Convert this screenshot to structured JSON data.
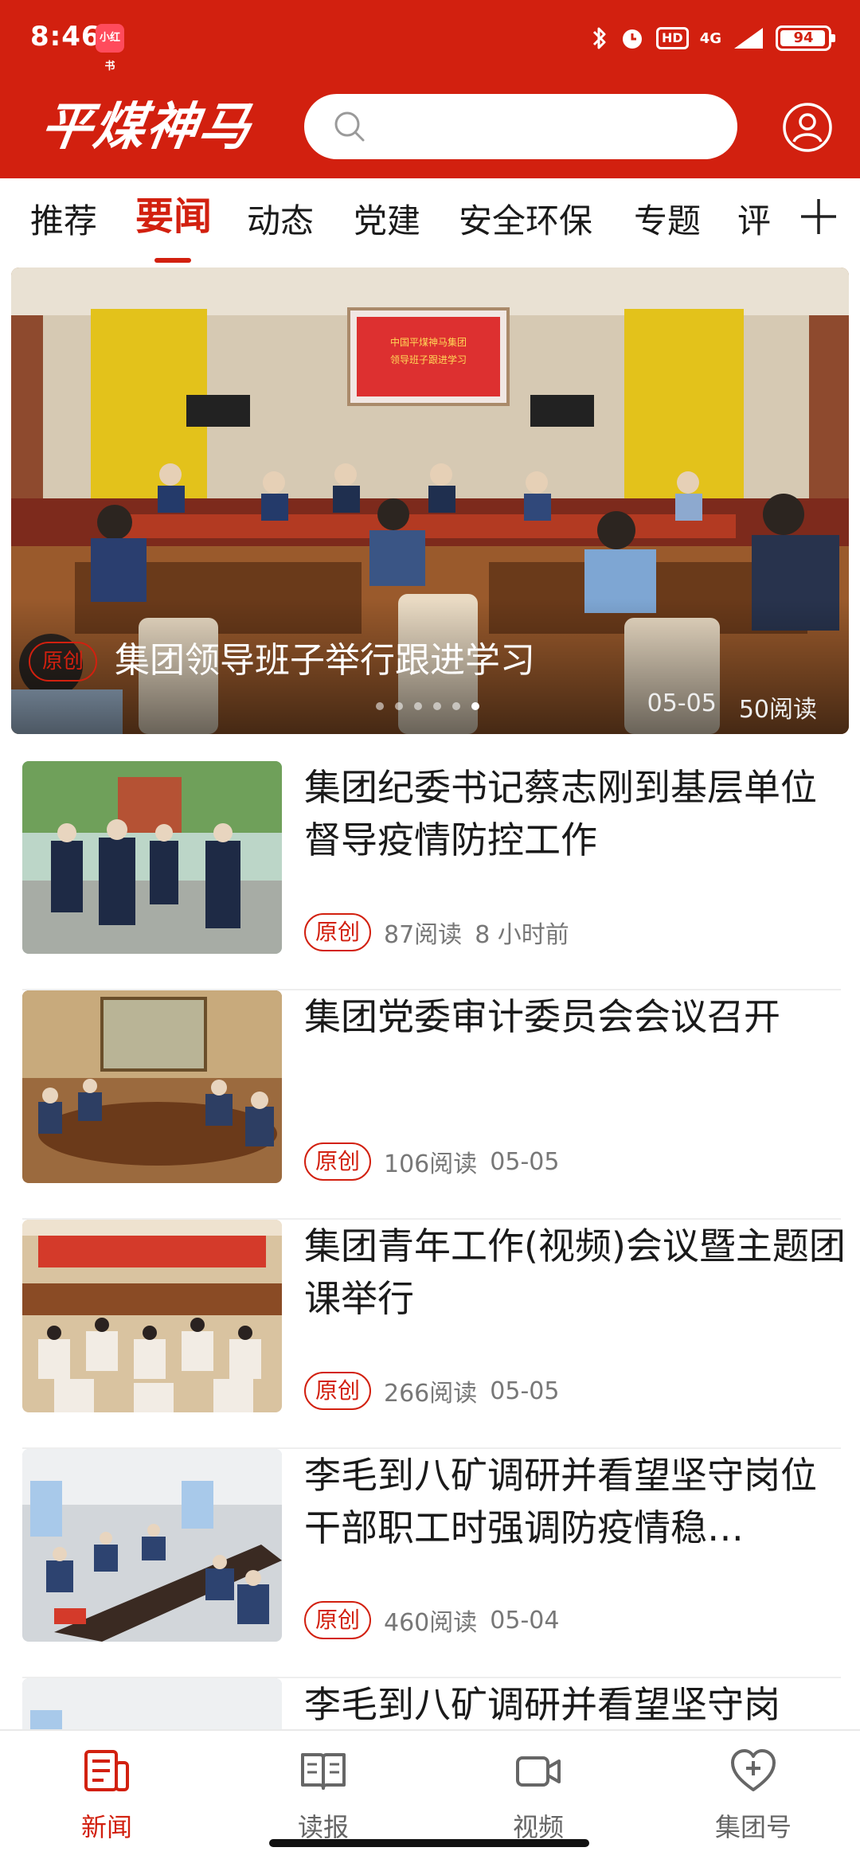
{
  "status_bar": {
    "time": "8:46",
    "app_badge": "小红书",
    "hd": "HD",
    "network": "4G",
    "battery": "94"
  },
  "header": {
    "logo_text": "平煤神马",
    "search_placeholder": "",
    "icons": [
      "search-icon",
      "user-icon"
    ],
    "brand_color": "#d2200f"
  },
  "tabs": {
    "items": [
      "推荐",
      "要闻",
      "动态",
      "党建",
      "安全环保",
      "专题",
      "评"
    ],
    "active": "要闻",
    "add_icon": "plus-icon"
  },
  "hero": {
    "tag": "原创",
    "title": "集团领导班子举行跟进学习",
    "date": "05-05",
    "reads": "50阅读",
    "slides_total": 6,
    "slide_active": 6,
    "screen_text_line1": "中国平煤神马集团",
    "screen_text_line2": "领导班子跟进学习"
  },
  "news": [
    {
      "title": "集团纪委书记蔡志刚到基层单位督导疫情防控工作",
      "badge": "原创",
      "reads": "87阅读",
      "time": "8 小时前"
    },
    {
      "title": "集团党委审计委员会会议召开",
      "badge": "原创",
      "reads": "106阅读",
      "time": "05-05"
    },
    {
      "title": "集团青年工作(视频)会议暨主题团课举行",
      "badge": "原创",
      "reads": "266阅读",
      "time": "05-05"
    },
    {
      "title": "李毛到八矿调研并看望坚守岗位干部职工时强调防疫情稳…",
      "badge": "原创",
      "reads": "460阅读",
      "time": "05-04"
    },
    {
      "title": "李毛到八矿调研并看望坚守岗",
      "badge": "",
      "reads": "",
      "time": ""
    }
  ],
  "bottom_nav": {
    "items": [
      {
        "label": "新闻",
        "icon": "news-icon"
      },
      {
        "label": "读报",
        "icon": "newspaper-icon"
      },
      {
        "label": "视频",
        "icon": "video-icon"
      },
      {
        "label": "集团号",
        "icon": "heart-plus-icon"
      }
    ],
    "active": "新闻"
  }
}
